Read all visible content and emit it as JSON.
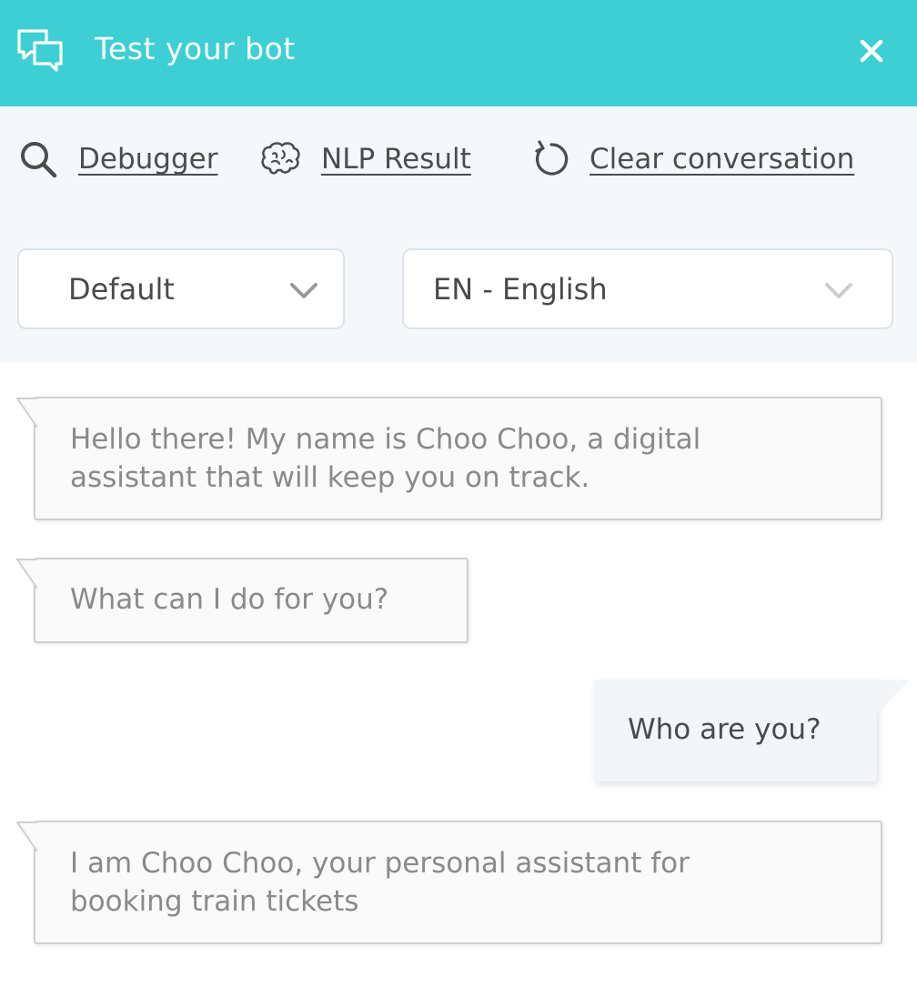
{
  "header": {
    "title": "Test your bot",
    "icon": "chat-bubbles-icon",
    "close_icon": "close-icon",
    "background_color": "#3dcfd3"
  },
  "toolbar": {
    "debugger_label": "Debugger",
    "nlp_label": "NLP Result",
    "clear_label": "Clear conversation",
    "debugger_icon": "search-icon",
    "nlp_icon": "brain-icon",
    "clear_icon": "refresh-icon"
  },
  "selects": {
    "version": "Default",
    "language": "EN - English"
  },
  "conversation": {
    "messages": [
      {
        "sender": "bot",
        "lines": [
          "Hello there! My name is Choo Choo, a digital",
          "assistant that will keep you on track."
        ]
      },
      {
        "sender": "bot",
        "lines": [
          "What can I do for you?"
        ]
      },
      {
        "sender": "user",
        "lines": [
          "Who are you?"
        ]
      },
      {
        "sender": "bot",
        "lines": [
          "I am Choo Choo, your personal assistant for",
          "booking train tickets"
        ]
      }
    ]
  }
}
